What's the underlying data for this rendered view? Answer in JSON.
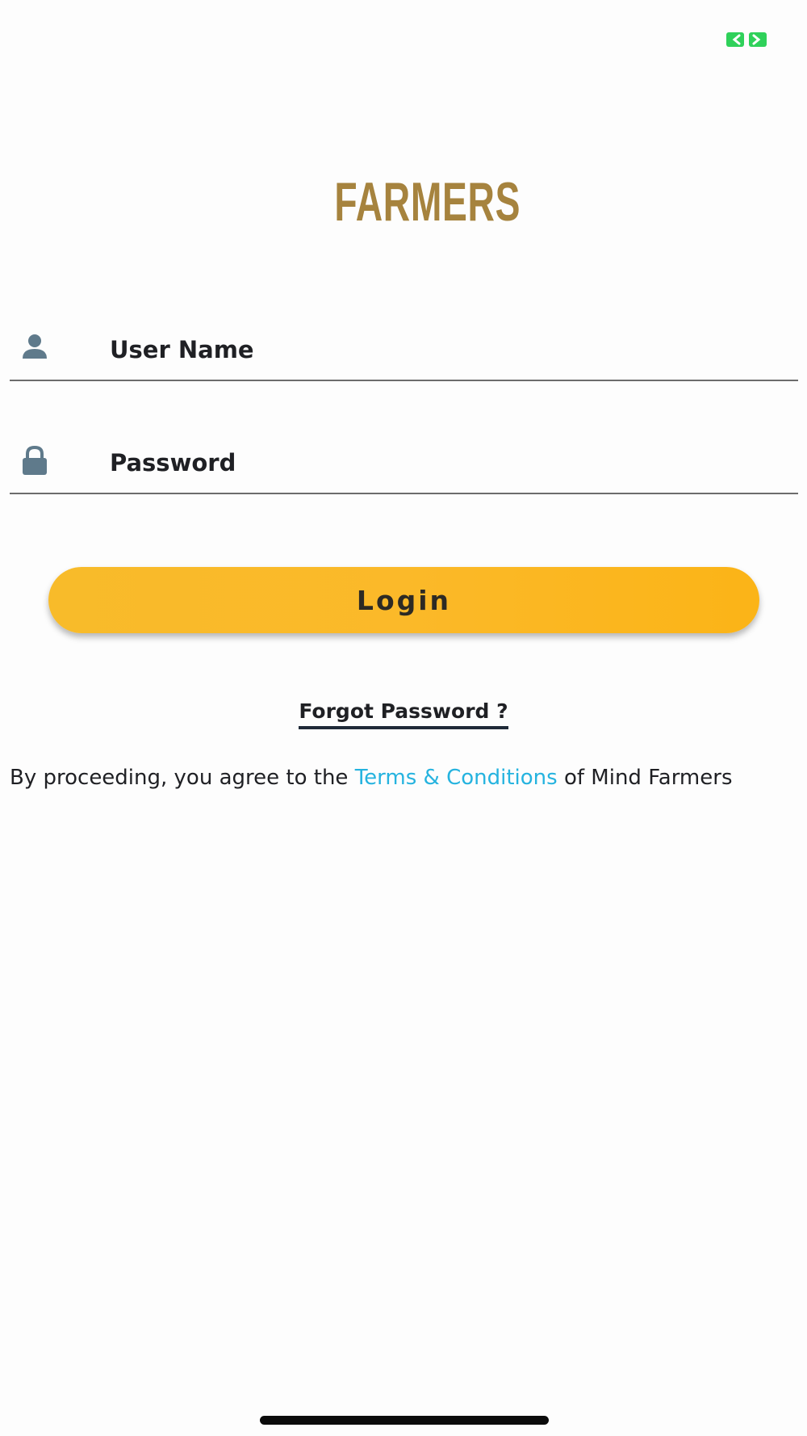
{
  "status_bar": {
    "indicator_icon": "green-screen-indicator-icon",
    "indicator_color": "#2fd15a"
  },
  "logo": {
    "text": "FARMERS",
    "color": "#a6833e"
  },
  "form": {
    "username": {
      "icon": "user-icon",
      "placeholder": "User Name",
      "value": ""
    },
    "password": {
      "icon": "lock-icon",
      "placeholder": "Password",
      "value": ""
    },
    "login_label": "Login",
    "forgot_label": "Forgot Password ?"
  },
  "terms": {
    "prefix": "By proceeding, you agree to the ",
    "link_text": "Terms & Conditions",
    "suffix": " of Mind Farmers",
    "link_color": "#25b3df"
  },
  "colors": {
    "accent": "#fbb929",
    "icon": "#5f7a8b",
    "text": "#1f2024",
    "divider": "#6c6c6c"
  }
}
